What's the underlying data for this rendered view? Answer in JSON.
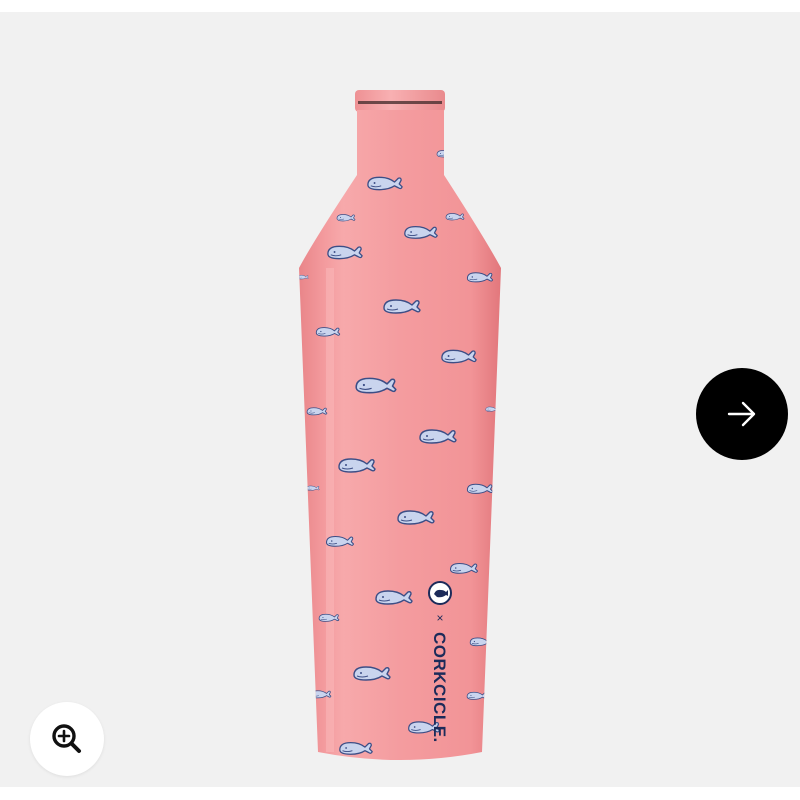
{
  "product": {
    "brand_wordmark": "CORKCICLE.",
    "collab_mark": "×",
    "colors": {
      "background": "#f1f1f1",
      "bottle_body": "#f49a9d",
      "bottle_cap": "#f5a4a6",
      "whale_fill": "#c9d4ee",
      "whale_outline": "#3c4e86",
      "logo_navy": "#1c2b5a"
    }
  },
  "controls": {
    "next_icon": "arrow-right-icon",
    "zoom_icon": "zoom-in-icon"
  }
}
